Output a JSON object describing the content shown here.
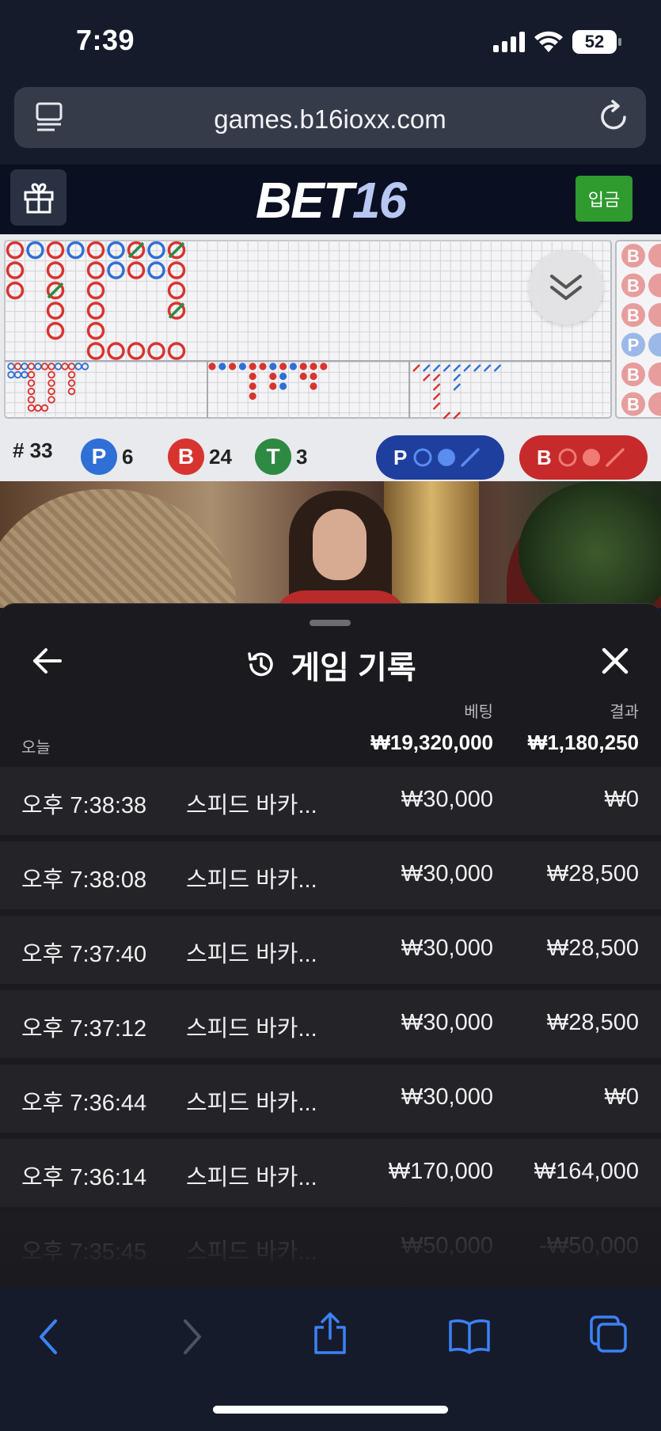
{
  "status_bar": {
    "time": "7:39",
    "battery": "52"
  },
  "browser": {
    "url": "games.b16ioxx.com"
  },
  "header": {
    "logo_part1": "BET",
    "logo_part2": "16",
    "deposit_label": "입금"
  },
  "roadmap": {
    "hand_count": "# 33",
    "player_chip": "P",
    "player_count": "6",
    "banker_chip": "B",
    "banker_count": "24",
    "tie_chip": "T",
    "tie_count": "3",
    "player_predict_label": "P",
    "banker_predict_label": "B",
    "side_column_labels": [
      "B",
      "B",
      "B",
      "P",
      "B",
      "B"
    ],
    "colors": {
      "player": "#2f6fd6",
      "banker": "#d8342f",
      "tie": "#2e8a42"
    }
  },
  "history": {
    "title": "게임 기록",
    "bet_header": "베팅",
    "result_header": "결과",
    "today_label": "오늘",
    "total_bet": "₩19,320,000",
    "total_result": "₩1,180,250",
    "rows": [
      {
        "time": "오후 7:38:38",
        "game": "스피드 바카...",
        "bet": "₩30,000",
        "result": "₩0"
      },
      {
        "time": "오후 7:38:08",
        "game": "스피드 바카...",
        "bet": "₩30,000",
        "result": "₩28,500"
      },
      {
        "time": "오후 7:37:40",
        "game": "스피드 바카...",
        "bet": "₩30,000",
        "result": "₩28,500"
      },
      {
        "time": "오후 7:37:12",
        "game": "스피드 바카...",
        "bet": "₩30,000",
        "result": "₩28,500"
      },
      {
        "time": "오후 7:36:44",
        "game": "스피드 바카...",
        "bet": "₩30,000",
        "result": "₩0"
      },
      {
        "time": "오후 7:36:14",
        "game": "스피드 바카...",
        "bet": "₩170,000",
        "result": "₩164,000"
      },
      {
        "time": "오후 7:35:45",
        "game": "스피드 바카...",
        "bet": "₩50,000",
        "result": "-₩50,000"
      }
    ]
  },
  "icons": {
    "back": "arrow-left-icon",
    "close": "close-icon",
    "history": "history-icon",
    "gift": "gift-icon",
    "collapse": "chevron-double-down-icon"
  }
}
